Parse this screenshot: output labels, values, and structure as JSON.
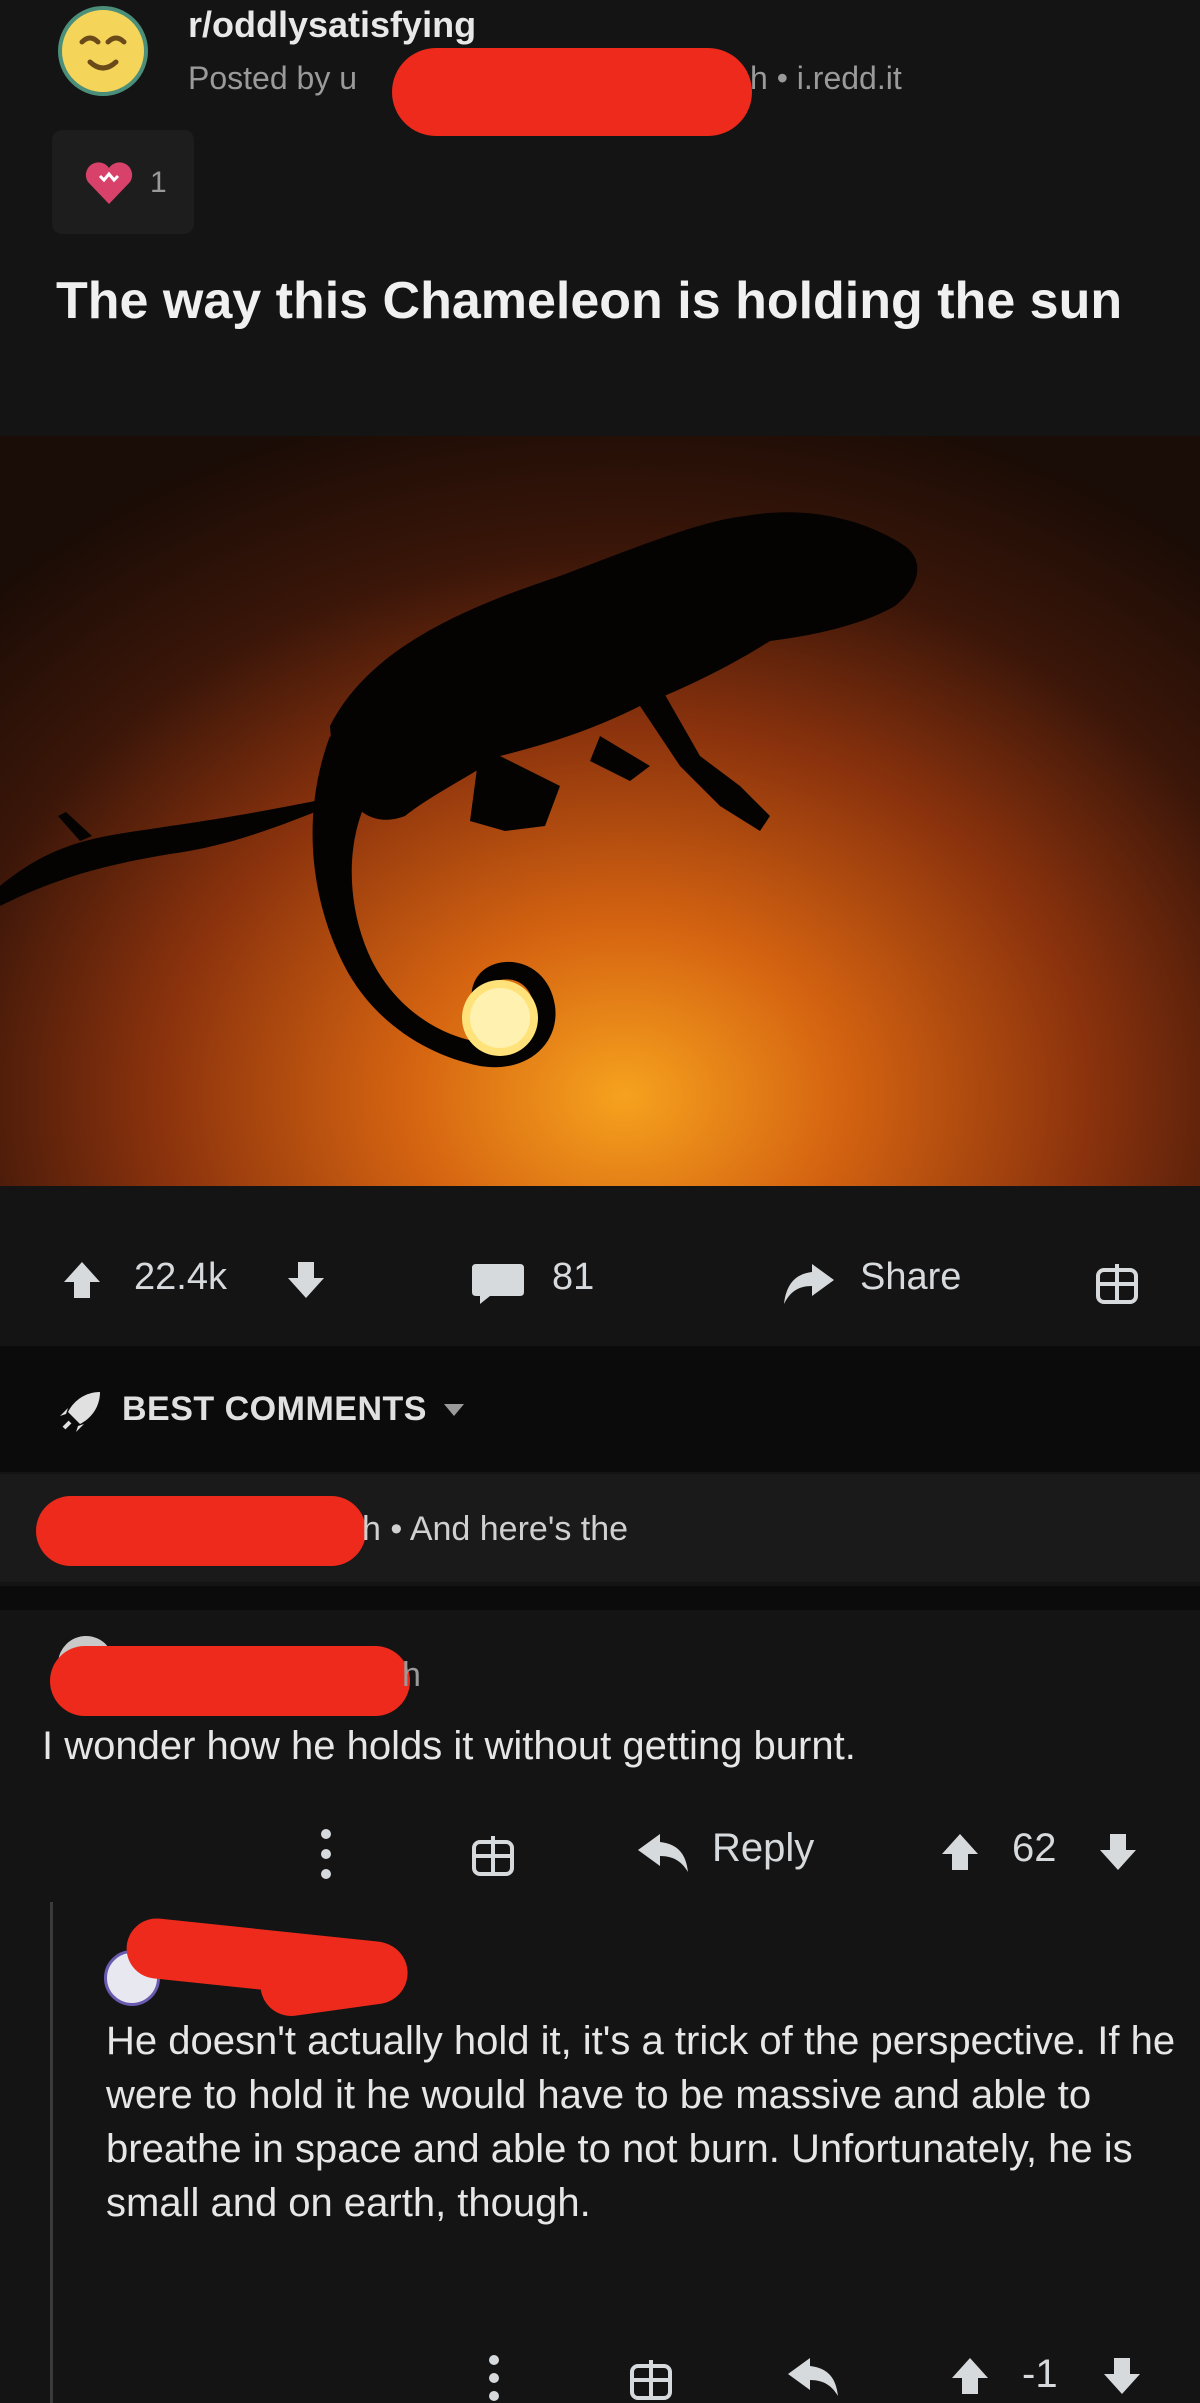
{
  "post": {
    "subreddit": "r/oddlysatisfying",
    "posted_by_prefix": "Posted by u",
    "meta_tail": "h • i.redd.it",
    "award_count": "1",
    "title": "The way this Chameleon is holding the sun"
  },
  "actions": {
    "upvotes": "22.4k",
    "comments": "81",
    "share_label": "Share"
  },
  "sort": {
    "label": "BEST COMMENTS"
  },
  "comments": [
    {
      "preview_tail": "h • And here's the"
    },
    {
      "time_fragment": "h",
      "text": "I wonder how he holds it without getting burnt.",
      "reply_label": "Reply",
      "score": "62"
    },
    {
      "text": "He doesn't actually hold it, it's a trick of the perspective. If he were to hold it he would have to be massive and able to breathe in space and able to not burn. Unfortunately, he is small and on earth, though.",
      "score": "-1"
    }
  ],
  "colors": {
    "background": "#141414",
    "redaction": "#ee2a1c",
    "sunset_core": "#f6a21e",
    "text": "#d7dadc"
  },
  "icons": [
    "relieved-face-avatar-icon",
    "heart-award-icon",
    "upvote-arrow-icon",
    "downvote-arrow-icon",
    "comment-bubble-icon",
    "share-arrow-icon",
    "gift-box-icon",
    "rocket-sort-icon",
    "chevron-down-icon",
    "more-vertical-icon",
    "reply-arrow-icon"
  ]
}
